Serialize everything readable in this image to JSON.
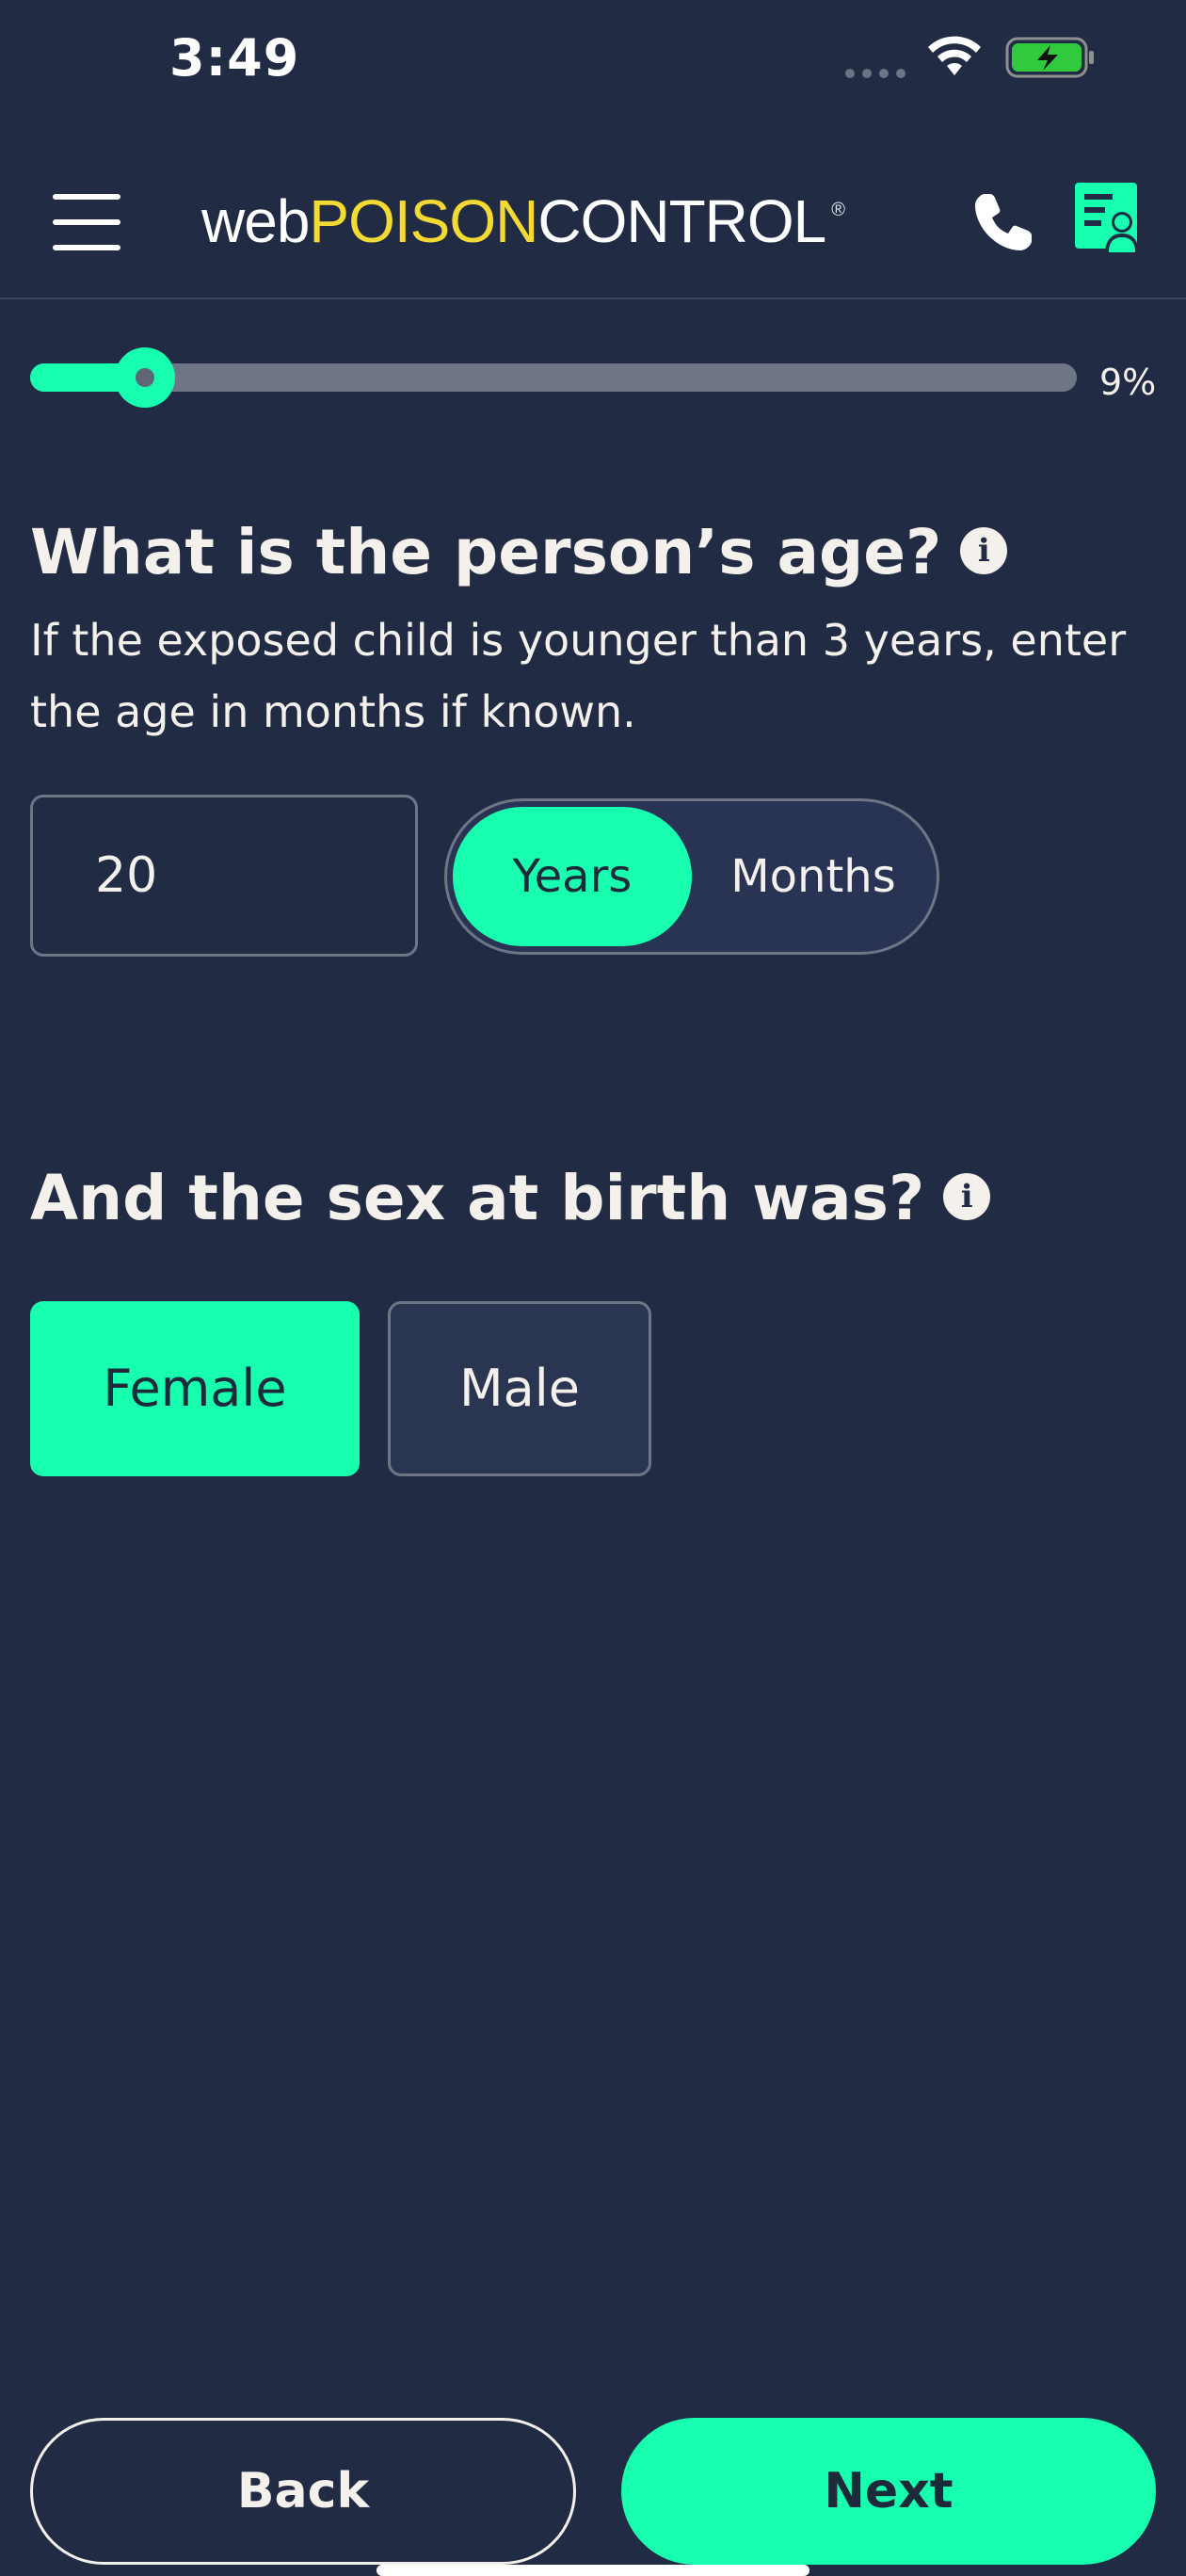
{
  "status_bar": {
    "time": "3:49"
  },
  "header": {
    "logo": {
      "part1": "web",
      "part2": "POISON",
      "part3": "CONTROL",
      "reg": "®"
    }
  },
  "progress": {
    "percent": 9,
    "label": "9%"
  },
  "age_question": {
    "title": "What is the person’s age?",
    "subtitle": "If the exposed child is younger than 3 years, enter the age in months if known.",
    "value": "20",
    "units": [
      "Years",
      "Months"
    ],
    "selected_unit": "Years"
  },
  "sex_question": {
    "title": "And the sex at birth was?",
    "options": [
      "Female",
      "Male"
    ],
    "selected": "Female"
  },
  "footer": {
    "back_label": "Back",
    "next_label": "Next"
  },
  "colors": {
    "background": "#222b44",
    "accent": "#19ffb0",
    "logo_yellow": "#f3d933",
    "text": "#f4f1ec"
  }
}
